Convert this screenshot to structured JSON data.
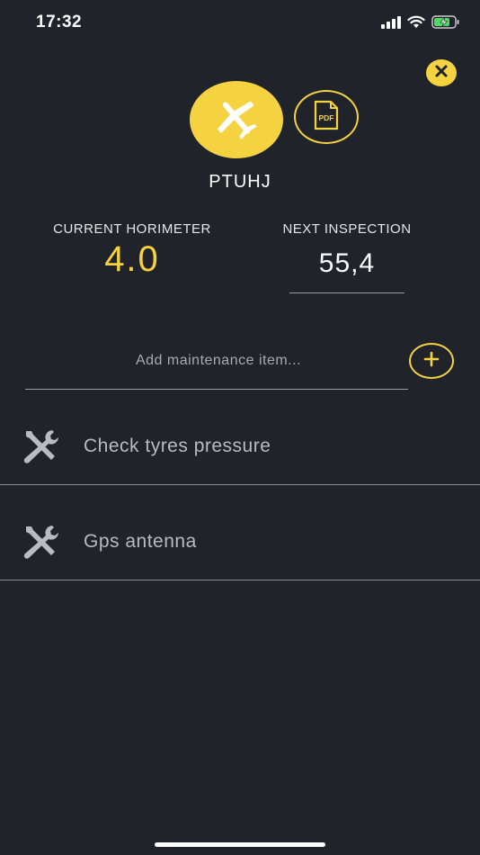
{
  "status_bar": {
    "time": "17:32",
    "icons": [
      "cellular-icon",
      "wifi-icon",
      "battery-charging-icon"
    ]
  },
  "header": {
    "aircraft_icon": "airplane-icon",
    "pdf_label": "PDF",
    "aircraft_name": "PTUHJ"
  },
  "stats": {
    "current_horimeter_label": "CURRENT HORIMETER",
    "current_horimeter_value": "4.0",
    "next_inspection_label": "NEXT INSPECTION",
    "next_inspection_value": "55,4"
  },
  "add_item": {
    "placeholder": "Add maintenance item...",
    "button_icon": "plus-icon"
  },
  "maintenance_items": [
    {
      "label": "Check tyres pressure",
      "icon": "tools-icon"
    },
    {
      "label": "Gps antenna",
      "icon": "tools-icon"
    }
  ],
  "colors": {
    "background": "#21232a",
    "accent": "#f5d240",
    "divider": "#8a8c92",
    "item_text": "#b9bbc1"
  }
}
